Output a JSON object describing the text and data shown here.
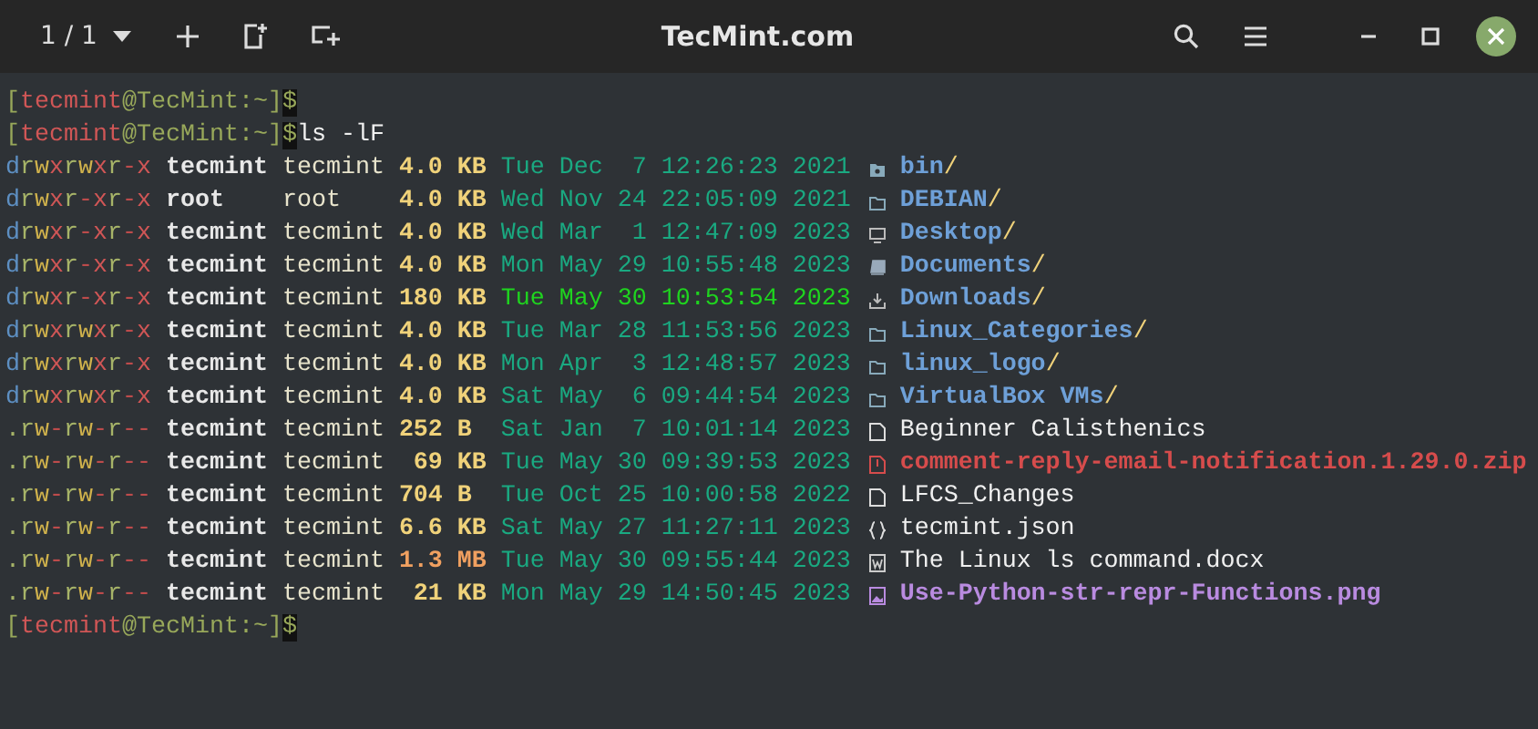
{
  "titlebar": {
    "tab_counter": "1 / 1",
    "title": "TecMint.com"
  },
  "terminal": {
    "lines": [
      {
        "kind": "prompt",
        "segments": [
          {
            "text": "[",
            "kind": "punct"
          },
          {
            "text": "tecmint",
            "kind": "user"
          },
          {
            "text": "@TecMint:~]",
            "kind": "host"
          },
          {
            "text": "$",
            "kind": "dollar"
          }
        ]
      },
      {
        "kind": "prompt",
        "segments": [
          {
            "text": "[",
            "kind": "punct"
          },
          {
            "text": "tecmint",
            "kind": "user"
          },
          {
            "text": "@TecMint:~]",
            "kind": "host"
          },
          {
            "text": "$",
            "kind": "dollar"
          },
          {
            "text": "ls -lF",
            "kind": "command"
          }
        ]
      },
      {
        "kind": "entry",
        "perms": "drwxrwxr-x",
        "owner": "tecmint",
        "group": "tecmint",
        "size": {
          "text": "4.0",
          "unit": "KB",
          "kind": "small"
        },
        "date": {
          "text": "Tue Dec  7 12:26:23 2021",
          "recent": false
        },
        "icon": {
          "kind": "folder-config"
        },
        "name": {
          "text": "bin",
          "suffix": "/",
          "kind": "dir"
        }
      },
      {
        "kind": "entry",
        "perms": "drwxr-xr-x",
        "owner": "root",
        "group": "root",
        "size": {
          "text": "4.0",
          "unit": "KB",
          "kind": "small"
        },
        "date": {
          "text": "Wed Nov 24 22:05:09 2021",
          "recent": false
        },
        "icon": {
          "kind": "folder"
        },
        "name": {
          "text": "DEBIAN",
          "suffix": "/",
          "kind": "dir"
        }
      },
      {
        "kind": "entry",
        "perms": "drwxr-xr-x",
        "owner": "tecmint",
        "group": "tecmint",
        "size": {
          "text": "4.0",
          "unit": "KB",
          "kind": "small"
        },
        "date": {
          "text": "Wed Mar  1 12:47:09 2023",
          "recent": false
        },
        "icon": {
          "kind": "monitor"
        },
        "name": {
          "text": "Desktop",
          "suffix": "/",
          "kind": "dir"
        }
      },
      {
        "kind": "entry",
        "perms": "drwxr-xr-x",
        "owner": "tecmint",
        "group": "tecmint",
        "size": {
          "text": "4.0",
          "unit": "KB",
          "kind": "small"
        },
        "date": {
          "text": "Mon May 29 10:55:48 2023",
          "recent": false
        },
        "icon": {
          "kind": "book"
        },
        "name": {
          "text": "Documents",
          "suffix": "/",
          "kind": "dir"
        }
      },
      {
        "kind": "entry",
        "perms": "drwxr-xr-x",
        "owner": "tecmint",
        "group": "tecmint",
        "size": {
          "text": "180",
          "unit": "KB",
          "kind": "small"
        },
        "date": {
          "text": "Tue May 30 10:53:54 2023",
          "recent": true
        },
        "icon": {
          "kind": "download"
        },
        "name": {
          "text": "Downloads",
          "suffix": "/",
          "kind": "dir"
        }
      },
      {
        "kind": "entry",
        "perms": "drwxrwxr-x",
        "owner": "tecmint",
        "group": "tecmint",
        "size": {
          "text": "4.0",
          "unit": "KB",
          "kind": "small"
        },
        "date": {
          "text": "Tue Mar 28 11:53:56 2023",
          "recent": false
        },
        "icon": {
          "kind": "folder"
        },
        "name": {
          "text": "Linux_Categories",
          "suffix": "/",
          "kind": "dir"
        }
      },
      {
        "kind": "entry",
        "perms": "drwxrwxr-x",
        "owner": "tecmint",
        "group": "tecmint",
        "size": {
          "text": "4.0",
          "unit": "KB",
          "kind": "small"
        },
        "date": {
          "text": "Mon Apr  3 12:48:57 2023",
          "recent": false
        },
        "icon": {
          "kind": "folder"
        },
        "name": {
          "text": "linux_logo",
          "suffix": "/",
          "kind": "dir"
        }
      },
      {
        "kind": "entry",
        "perms": "drwxrwxr-x",
        "owner": "tecmint",
        "group": "tecmint",
        "size": {
          "text": "4.0",
          "unit": "KB",
          "kind": "small"
        },
        "date": {
          "text": "Sat May  6 09:44:54 2023",
          "recent": false
        },
        "icon": {
          "kind": "folder"
        },
        "name": {
          "text": "VirtualBox VMs",
          "suffix": "/",
          "kind": "dir"
        }
      },
      {
        "kind": "entry",
        "perms": ".rw-rw-r--",
        "owner": "tecmint",
        "group": "tecmint",
        "size": {
          "text": "252",
          "unit": "B",
          "kind": "small"
        },
        "date": {
          "text": "Sat Jan  7 10:01:14 2023",
          "recent": false
        },
        "icon": {
          "kind": "file"
        },
        "name": {
          "text": "Beginner Calisthenics",
          "kind": "file"
        }
      },
      {
        "kind": "entry",
        "perms": ".rw-rw-r--",
        "owner": "tecmint",
        "group": "tecmint",
        "size": {
          "text": "69",
          "unit": "KB",
          "kind": "small"
        },
        "date": {
          "text": "Tue May 30 09:39:53 2023",
          "recent": false
        },
        "icon": {
          "kind": "zip"
        },
        "name": {
          "text": "comment-reply-email-notification.1.29.0.zip",
          "kind": "archive"
        }
      },
      {
        "kind": "entry",
        "perms": ".rw-rw-r--",
        "owner": "tecmint",
        "group": "tecmint",
        "size": {
          "text": "704",
          "unit": "B",
          "kind": "small"
        },
        "date": {
          "text": "Tue Oct 25 10:00:58 2022",
          "recent": false
        },
        "icon": {
          "kind": "file"
        },
        "name": {
          "text": "LFCS_Changes",
          "kind": "file"
        }
      },
      {
        "kind": "entry",
        "perms": ".rw-rw-r--",
        "owner": "tecmint",
        "group": "tecmint",
        "size": {
          "text": "6.6",
          "unit": "KB",
          "kind": "small"
        },
        "date": {
          "text": "Sat May 27 11:27:11 2023",
          "recent": false
        },
        "icon": {
          "kind": "braces"
        },
        "name": {
          "text": "tecmint.json",
          "kind": "file"
        }
      },
      {
        "kind": "entry",
        "perms": ".rw-rw-r--",
        "owner": "tecmint",
        "group": "tecmint",
        "size": {
          "text": "1.3",
          "unit": "MB",
          "kind": "large"
        },
        "date": {
          "text": "Tue May 30 09:55:44 2023",
          "recent": false
        },
        "icon": {
          "kind": "word"
        },
        "name": {
          "text": "The Linux ls command.docx",
          "kind": "file"
        }
      },
      {
        "kind": "entry",
        "perms": ".rw-rw-r--",
        "owner": "tecmint",
        "group": "tecmint",
        "size": {
          "text": "21",
          "unit": "KB",
          "kind": "small"
        },
        "date": {
          "text": "Mon May 29 14:50:45 2023",
          "recent": false
        },
        "icon": {
          "kind": "image"
        },
        "name": {
          "text": "Use-Python-str-repr-Functions.png",
          "kind": "image"
        }
      },
      {
        "kind": "prompt",
        "segments": [
          {
            "text": "[",
            "kind": "punct"
          },
          {
            "text": "tecmint",
            "kind": "user"
          },
          {
            "text": "@TecMint:~]",
            "kind": "host"
          },
          {
            "text": "$",
            "kind": "dollar"
          }
        ]
      }
    ]
  }
}
